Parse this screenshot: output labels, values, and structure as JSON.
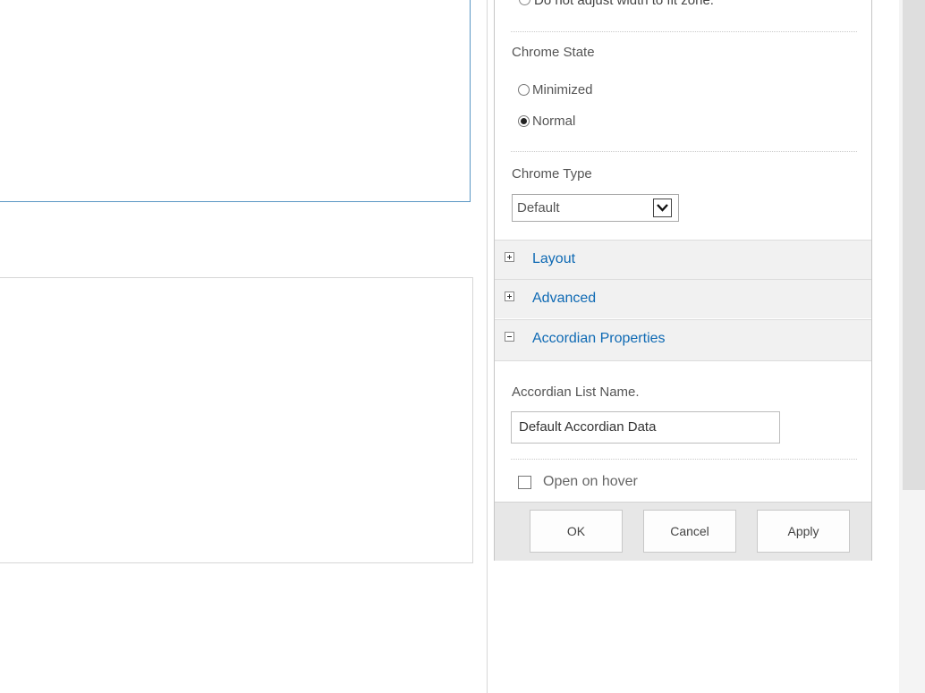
{
  "partial_option": "Do not adjust width to fit zone.",
  "chrome_state": {
    "label": "Chrome State",
    "options": [
      {
        "label": "Minimized",
        "selected": false
      },
      {
        "label": "Normal",
        "selected": true
      }
    ]
  },
  "chrome_type": {
    "label": "Chrome Type",
    "value": "Default"
  },
  "sections": {
    "layout": {
      "label": "Layout",
      "expanded": false
    },
    "advanced": {
      "label": "Advanced",
      "expanded": false
    },
    "accordian": {
      "label": "Accordian Properties",
      "expanded": true
    }
  },
  "accordian_props": {
    "list_name_label": "Accordian List Name.",
    "list_name_value": "Default Accordian Data",
    "hover_label": "Open on hover",
    "hover_checked": false
  },
  "buttons": {
    "ok": "OK",
    "cancel": "Cancel",
    "apply": "Apply"
  },
  "colors": {
    "link": "#0f6ab4",
    "web_part_border": "#5a97c4",
    "section_bg": "#f1f1f1"
  }
}
